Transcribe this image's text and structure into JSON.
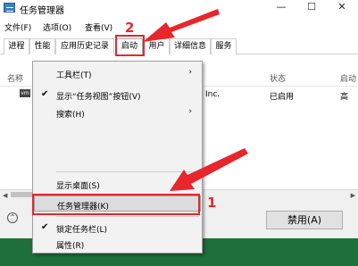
{
  "window": {
    "title": "任务管理器",
    "controls": {
      "minimize": "—",
      "maximize": "☐",
      "close": "✕"
    }
  },
  "menubar": [
    {
      "label": "文件(F)"
    },
    {
      "label": "选项(O)"
    },
    {
      "label": "查看(V)"
    }
  ],
  "tabs": [
    {
      "label": "进程"
    },
    {
      "label": "性能"
    },
    {
      "label": "应用历史记录"
    },
    {
      "label": "启动",
      "active": true
    },
    {
      "label": "用户"
    },
    {
      "label": "详细信息"
    },
    {
      "label": "服务"
    }
  ],
  "table": {
    "columns": [
      "名称",
      "状态",
      "启动"
    ],
    "row": {
      "icon_text": "vm",
      "publisher_fragment": "Inc.",
      "status": "已启用",
      "impact": "高"
    }
  },
  "footer": {
    "collapse_icon": "⌃",
    "disable_button": "禁用(A)"
  },
  "context_menu": {
    "items": [
      {
        "label": "工具栏(T)",
        "submenu": "›"
      },
      {
        "label": "显示“任务视图”按钮(V)",
        "check": "✔"
      },
      {
        "label": "搜索(H)",
        "submenu": "›"
      },
      {
        "label": "显示桌面(S)"
      },
      {
        "label": "任务管理器(K)"
      },
      {
        "label": "锁定任务栏(L)",
        "check": "✔"
      },
      {
        "label": "属性(R)"
      }
    ]
  },
  "annotations": {
    "step1": "1",
    "step2": "2",
    "color": "#e8262b"
  },
  "colors": {
    "taskbar": "#1f6f3a",
    "footer_bg": "#f0f0f0",
    "menu_bg": "#f2f2f2"
  }
}
